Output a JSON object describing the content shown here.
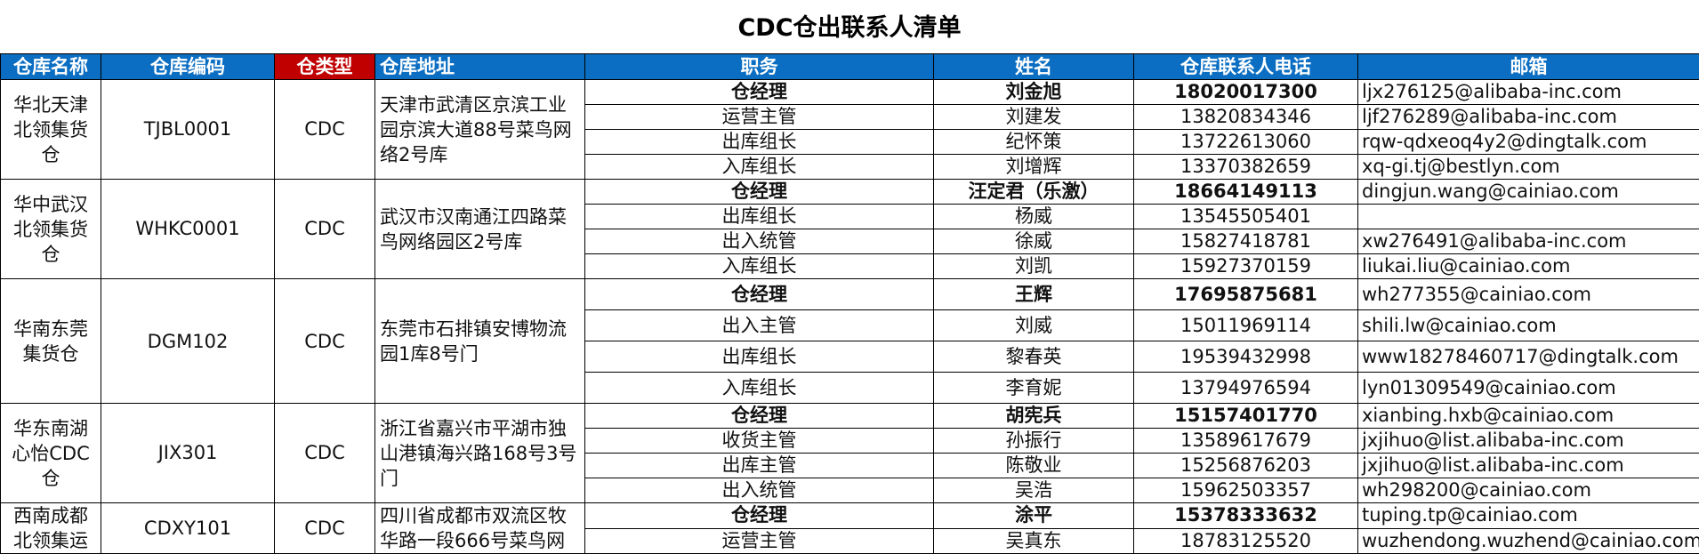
{
  "title": "CDC仓出联系人清单",
  "headers": [
    "仓库名称",
    "仓库编码",
    "仓类型",
    "仓库地址",
    "职务",
    "姓名",
    "仓库联系人电话",
    "邮箱"
  ],
  "warehouses": [
    {
      "name": "华北天津北领集货仓",
      "code": "TJBL0001",
      "type": "CDC",
      "address": "天津市武清区京滨工业园京滨大道88号菜鸟网络2号库",
      "contacts": [
        {
          "role": "仓经理",
          "name": "刘金旭",
          "phone": "18020017300",
          "email": "ljx276125@alibaba-inc.com"
        },
        {
          "role": "运营主管",
          "name": "刘建发",
          "phone": "13820834346",
          "email": "ljf276289@alibaba-inc.com"
        },
        {
          "role": "出库组长",
          "name": "纪怀策",
          "phone": "13722613060",
          "email": "rqw-qdxeoq4y2@dingtalk.com"
        },
        {
          "role": "入库组长",
          "name": "刘增辉",
          "phone": "13370382659",
          "email": "xq-gi.tj@bestlyn.com"
        }
      ]
    },
    {
      "name": "华中武汉北领集货仓",
      "code": "WHKC0001",
      "type": "CDC",
      "address": "武汉市汉南通江四路菜鸟网络园区2号库",
      "contacts": [
        {
          "role": "仓经理",
          "name": "汪定君（乐激）",
          "phone": "18664149113",
          "email": "dingjun.wang@cainiao.com"
        },
        {
          "role": "出库组长",
          "name": "杨威",
          "phone": "13545505401",
          "email": ""
        },
        {
          "role": "出入统管",
          "name": "徐威",
          "phone": "15827418781",
          "email": "xw276491@alibaba-inc.com"
        },
        {
          "role": "入库组长",
          "name": "刘凯",
          "phone": "15927370159",
          "email": "liukai.liu@cainiao.com"
        }
      ]
    },
    {
      "name": "华南东莞集货仓",
      "code": "DGM102",
      "type": "CDC",
      "address": "东莞市石排镇安博物流园1库8号门",
      "contacts": [
        {
          "role": "仓经理",
          "name": "王辉",
          "phone": "17695875681",
          "email": "wh277355@cainiao.com"
        },
        {
          "role": "出入主管",
          "name": "刘威",
          "phone": "15011969114",
          "email": "shili.lw@cainiao.com"
        },
        {
          "role": "出库组长",
          "name": "黎春英",
          "phone": "19539432998",
          "email": "www18278460717@dingtalk.com"
        },
        {
          "role": "入库组长",
          "name": "李育妮",
          "phone": "13794976594",
          "email": "lyn01309549@cainiao.com"
        }
      ]
    },
    {
      "name": "华东南湖心怡CDC仓",
      "code": "JIX301",
      "type": "CDC",
      "address": "浙江省嘉兴市平湖市独山港镇海兴路168号3号门",
      "contacts": [
        {
          "role": "仓经理",
          "name": "胡宪兵",
          "phone": "15157401770",
          "email": "xianbing.hxb@cainiao.com"
        },
        {
          "role": "收货主管",
          "name": "孙振行",
          "phone": "13589617679",
          "email": "jxjihuo@list.alibaba-inc.com"
        },
        {
          "role": "出库主管",
          "name": "陈敬业",
          "phone": "15256876203",
          "email": "jxjihuo@list.alibaba-inc.com"
        },
        {
          "role": "出入统管",
          "name": "吴浩",
          "phone": "15962503357",
          "email": "wh298200@cainiao.com"
        }
      ]
    },
    {
      "name": "西南成都北领集运",
      "code": "CDXY101",
      "type": "CDC",
      "address": "四川省成都市双流区牧华路一段666号菜鸟网",
      "contacts": [
        {
          "role": "仓经理",
          "name": "涂平",
          "phone": "15378333632",
          "email": "tuping.tp@cainiao.com"
        },
        {
          "role": "运营主管",
          "name": "吴真东",
          "phone": "18783125520",
          "email": "wuzhendong.wuzhend@cainiao.com"
        }
      ]
    }
  ]
}
